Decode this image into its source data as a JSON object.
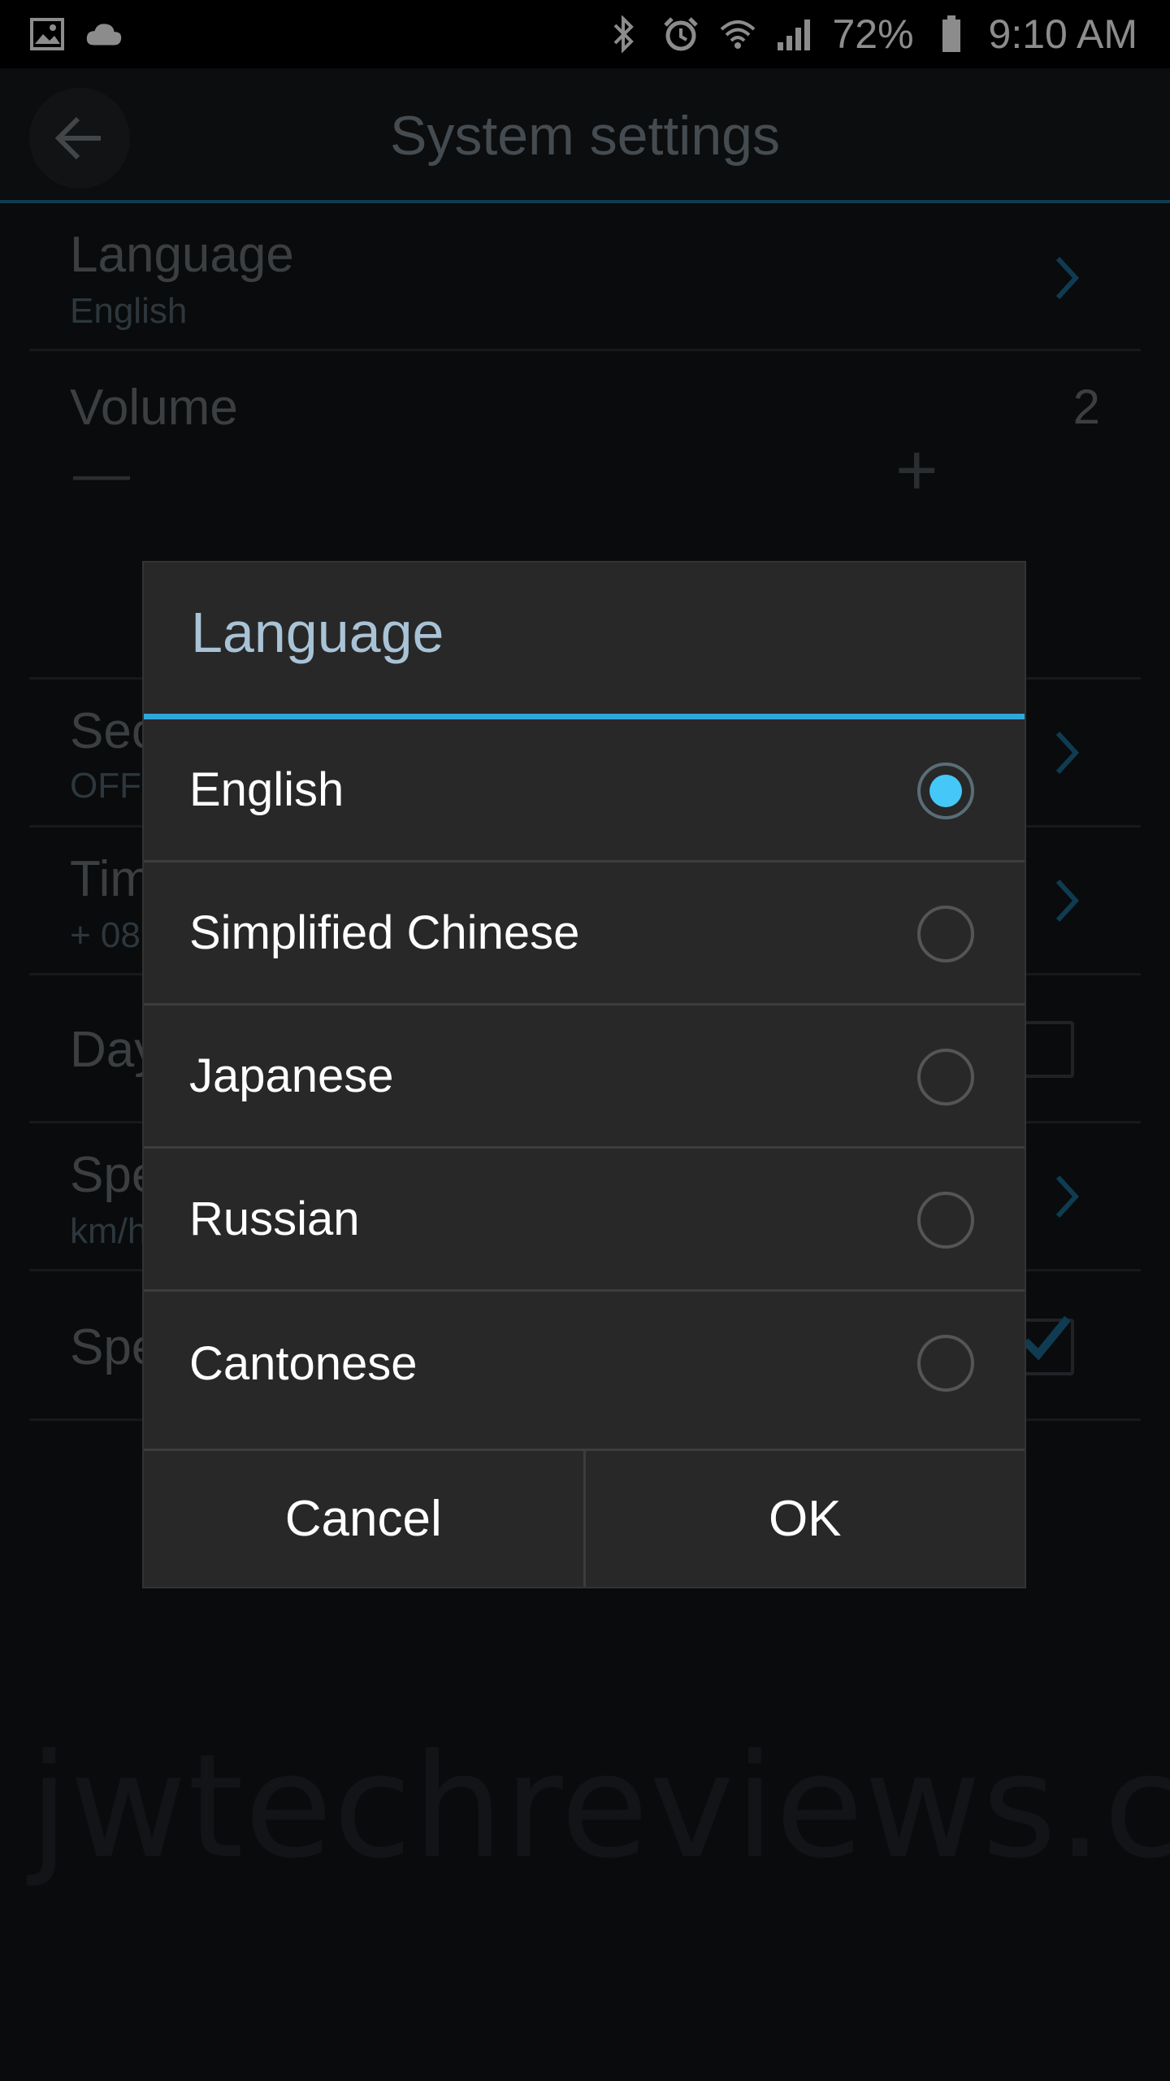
{
  "status_bar": {
    "left_icons": [
      "image-icon",
      "cloud-icon"
    ],
    "right_icons": [
      "bluetooth-icon",
      "alarm-icon",
      "wifi-icon",
      "signal-icon"
    ],
    "battery": "72%",
    "time": "9:10 AM"
  },
  "header": {
    "title": "System settings"
  },
  "settings": {
    "language": {
      "title": "Language",
      "value": "English"
    },
    "volume": {
      "title": "Volume",
      "value": "2",
      "minus": "—",
      "plus": "+",
      "level_fraction": 0.667
    },
    "row3": {
      "title": "Sec",
      "value": "OFF"
    },
    "row4": {
      "title": "Tim",
      "value": "+ 08:"
    },
    "row5": {
      "title": "Day"
    },
    "row6": {
      "title": "Spe",
      "value": "km/h"
    },
    "row7": {
      "title": "Spe"
    }
  },
  "watermark": "jwtechreviews.com",
  "dialog": {
    "title": "Language",
    "options": [
      {
        "label": "English",
        "selected": true
      },
      {
        "label": "Simplified Chinese",
        "selected": false
      },
      {
        "label": "Japanese",
        "selected": false
      },
      {
        "label": "Russian",
        "selected": false
      },
      {
        "label": "Cantonese",
        "selected": false
      }
    ],
    "cancel_label": "Cancel",
    "ok_label": "OK"
  },
  "colors": {
    "accent": "#30a7da",
    "radio_selected": "#45c8f7"
  }
}
